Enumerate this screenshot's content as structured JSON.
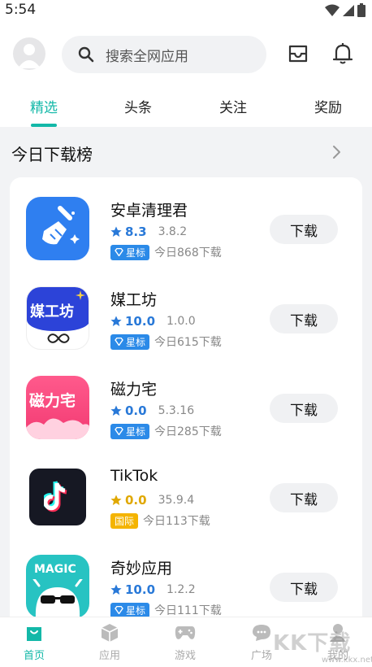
{
  "status_bar": {
    "time": "5:54"
  },
  "search": {
    "placeholder": "搜索全网应用"
  },
  "tabs": [
    {
      "label": "精选",
      "active": true
    },
    {
      "label": "头条",
      "active": false
    },
    {
      "label": "关注",
      "active": false
    },
    {
      "label": "奖励",
      "active": false
    }
  ],
  "section": {
    "title": "今日下载榜"
  },
  "apps": [
    {
      "name": "安卓清理君",
      "score": "8.3",
      "version": "3.8.2",
      "badge": "星标",
      "downloads": "今日868下载",
      "button": "下载"
    },
    {
      "name": "媒工坊",
      "score": "10.0",
      "version": "1.0.0",
      "badge": "星标",
      "downloads": "今日615下载",
      "button": "下载"
    },
    {
      "name": "磁力宅",
      "score": "0.0",
      "version": "5.3.16",
      "badge": "星标",
      "downloads": "今日285下载",
      "button": "下载"
    },
    {
      "name": "TikTok",
      "score": "0.0",
      "version": "35.9.4",
      "badge": "国际",
      "downloads": "今日113下载",
      "button": "下载"
    },
    {
      "name": "奇妙应用",
      "score": "10.0",
      "version": "1.2.2",
      "badge": "星标",
      "downloads": "今日111下载",
      "button": "下载"
    }
  ],
  "app_icon_text": {
    "meigongfang": "媒工坊",
    "ciliz": "磁力宅",
    "magic": "MAGIC"
  },
  "bottom_nav": [
    {
      "label": "首页",
      "icon": "home-bag-icon",
      "active": true
    },
    {
      "label": "应用",
      "icon": "cube-icon",
      "active": false
    },
    {
      "label": "游戏",
      "icon": "gamepad-icon",
      "active": false
    },
    {
      "label": "广场",
      "icon": "chat-bubble-icon",
      "active": false
    },
    {
      "label": "我的",
      "icon": "person-icon",
      "active": false
    }
  ],
  "watermark": {
    "text": "KK下载",
    "url": "www.kkx.net"
  },
  "colors": {
    "accent": "#13b8a8",
    "star_blue": "#2979d8",
    "star_gold": "#e0a800",
    "badge_blue": "#2b8ae8",
    "badge_gold": "#f4b400"
  }
}
